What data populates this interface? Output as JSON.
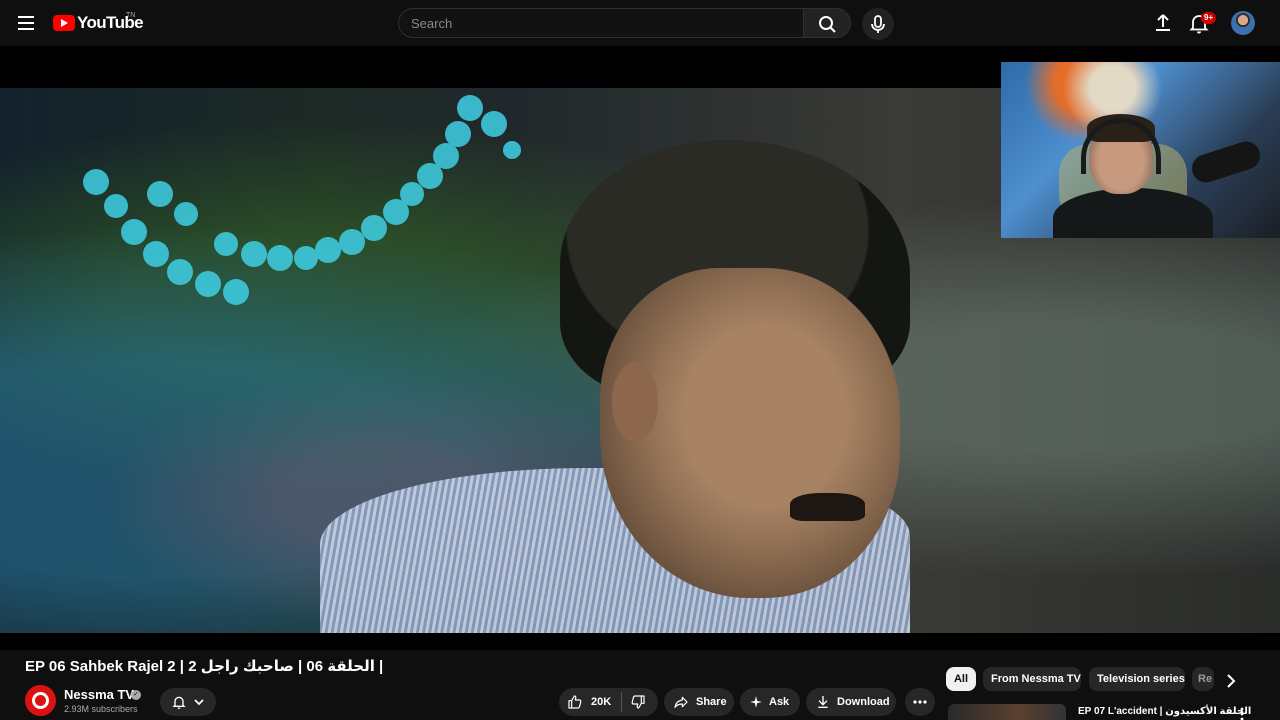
{
  "header": {
    "logo_text": "YouTube",
    "logo_tm": "TN",
    "search_placeholder": "Search",
    "notification_badge": "9+"
  },
  "video": {
    "title": "EP 06 Sahbek Rajel 2 | الحلقة 06 | صاحبك راجل 2 |"
  },
  "channel": {
    "name": "Nessma TV",
    "subscribers": "2.93M subscribers"
  },
  "actions": {
    "like_count": "20K",
    "share_label": "Share",
    "ask_label": "Ask",
    "download_label": "Download"
  },
  "chips": [
    "All",
    "From Nessma TV",
    "Television series",
    "Re"
  ],
  "recommendation": {
    "title": "EP 07 L'accident | الحلقة الأكسيدون"
  },
  "colors": {
    "background": "#0f0f0f",
    "brand_red": "#ff0000",
    "pill_bg": "#272727",
    "badge_red": "#cc0000"
  }
}
